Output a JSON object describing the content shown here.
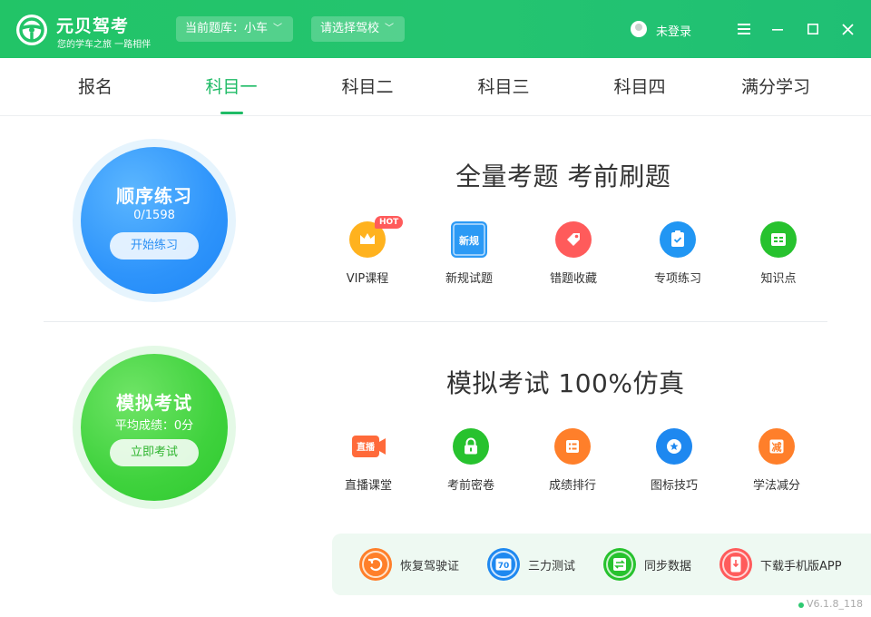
{
  "header": {
    "app_name": "元贝驾考",
    "slogan": "您的学车之旅 一路相伴",
    "question_bank": "当前题库：小车",
    "school_select": "请选择驾校",
    "login_status": "未登录"
  },
  "tabs": [
    {
      "label": "报名"
    },
    {
      "label": "科目一"
    },
    {
      "label": "科目二"
    },
    {
      "label": "科目三"
    },
    {
      "label": "科目四"
    },
    {
      "label": "满分学习"
    }
  ],
  "practice": {
    "title": "顺序练习",
    "progress": "0/1598",
    "button": "开始练习",
    "heading": "全量考题  考前刷题",
    "features": [
      {
        "label": "VIP课程",
        "icon": "crown-icon",
        "badge": "HOT"
      },
      {
        "label": "新规试题",
        "icon": "new-rules-icon",
        "icon_text": "新规"
      },
      {
        "label": "错题收藏",
        "icon": "tag-icon"
      },
      {
        "label": "专项练习",
        "icon": "clipboard-check-icon"
      },
      {
        "label": "知识点",
        "icon": "book-icon"
      }
    ]
  },
  "exam": {
    "title": "模拟考试",
    "score_line": "平均成绩：0分",
    "button": "立即考试",
    "heading": "模拟考试  100%仿真",
    "features": [
      {
        "label": "直播课堂",
        "icon": "live-video-icon",
        "icon_text": "直播"
      },
      {
        "label": "考前密卷",
        "icon": "lock-icon"
      },
      {
        "label": "成绩排行",
        "icon": "list-icon"
      },
      {
        "label": "图标技巧",
        "icon": "star-icon"
      },
      {
        "label": "学法减分",
        "icon": "reduce-points-icon",
        "icon_text": "减"
      }
    ]
  },
  "bottom_bar": [
    {
      "label": "恢复驾驶证",
      "icon": "restore-icon"
    },
    {
      "label": "三力测试",
      "icon": "score-70-icon",
      "icon_text": "70"
    },
    {
      "label": "同步数据",
      "icon": "sync-icon"
    },
    {
      "label": "下载手机版APP",
      "icon": "phone-download-icon"
    }
  ],
  "version": "V6.1.8_118",
  "colors": {
    "brand_green": "#22c467",
    "active_tab": "#1fbb66",
    "practice_blue": "#2e94fb",
    "exam_green": "#3fd23d"
  }
}
